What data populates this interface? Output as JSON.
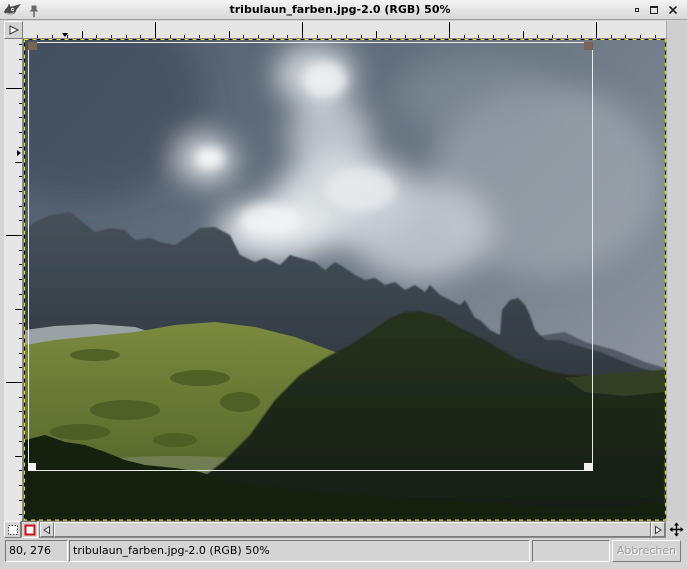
{
  "window": {
    "title": "tribulaun_farben.jpg-2.0 (RGB) 50%",
    "app_icon": "gimp-wilber-icon",
    "pin_icon": "pin-icon",
    "controls": [
      "minimize-icon",
      "maximize-icon",
      "close-icon"
    ]
  },
  "canvas": {
    "menu_button_icon": "menu-arrow-icon",
    "layer_boundary_color": "#e8e800",
    "selection_color": "#ececec",
    "handle_top_color": "#7b6552",
    "handle_bottom_color": "#f4f0f2"
  },
  "bottom_bar": {
    "quick_mask_off_icon": "quick-mask-off-icon",
    "quick_mask_on_icon": "quick-mask-on-icon",
    "quick_mask_color": "#d01010",
    "scroll_left_icon": "scroll-left-icon",
    "scroll_right_icon": "scroll-right-icon",
    "navigate_icon": "navigate-icon",
    "horizontal_scroll": {
      "visible_fraction": 1,
      "position": 0
    }
  },
  "status_bar": {
    "coordinates": "80, 276",
    "message": "tribulaun_farben.jpg-2.0 (RGB) 50%",
    "progress": "",
    "cancel_label": "Abbrechen",
    "cancel_enabled": false
  }
}
